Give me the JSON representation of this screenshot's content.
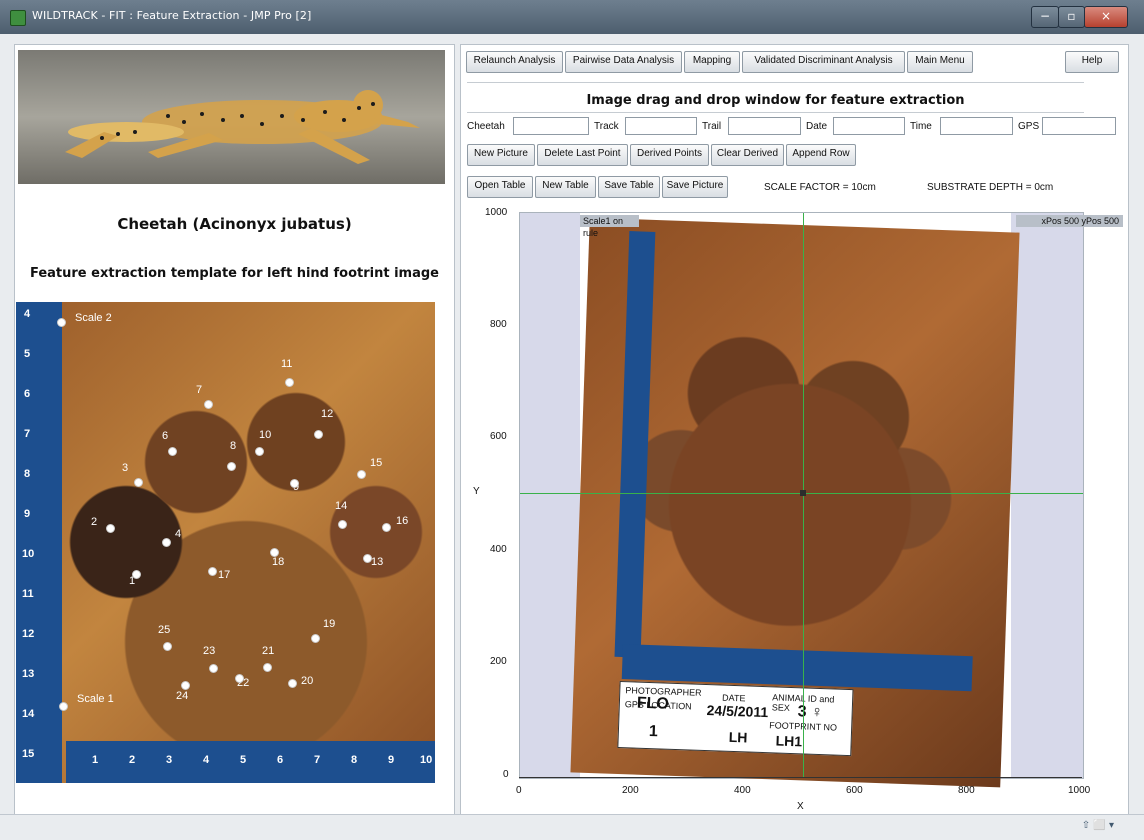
{
  "window": {
    "title": "WILDTRACK - FIT : Feature Extraction - JMP Pro [2]"
  },
  "left": {
    "species": "Cheetah (Acinonyx jubatus)",
    "template_title": "Feature extraction template for left hind footrint image",
    "scale2": "Scale 2",
    "scale1": "Scale 1",
    "landmarks": [
      "1",
      "2",
      "3",
      "4",
      "6",
      "7",
      "8",
      "9",
      "10",
      "11",
      "12",
      "13",
      "14",
      "15",
      "16",
      "17",
      "18",
      "19",
      "20",
      "21",
      "22",
      "23",
      "24",
      "25"
    ],
    "left_ruler": [
      "4",
      "5",
      "6",
      "7",
      "8",
      "9",
      "10",
      "11",
      "12",
      "13",
      "14",
      "15"
    ],
    "bottom_ruler": [
      "1",
      "2",
      "3",
      "4",
      "5",
      "6",
      "7",
      "8",
      "9",
      "10"
    ]
  },
  "toolbar": {
    "relaunch": "Relaunch Analysis",
    "pairwise": "Pairwise Data Analysis",
    "mapping": "Mapping",
    "validated": "Validated Discriminant Analysis",
    "main_menu": "Main Menu",
    "help": "Help"
  },
  "right": {
    "window_title": "Image drag and drop window for feature extraction",
    "fields": {
      "cheetah": "Cheetah",
      "track": "Track",
      "trail": "Trail",
      "date": "Date",
      "time": "Time",
      "gps": "GPS"
    },
    "actions": {
      "new_picture": "New Picture",
      "delete_last_point": "Delete Last Point",
      "derived_points": "Derived Points",
      "clear_derived": "Clear Derived",
      "append_row": "Append Row",
      "open_table": "Open Table",
      "new_table": "New Table",
      "save_table": "Save Table",
      "save_picture": "Save Picture"
    },
    "scale_factor": "SCALE FACTOR = 10cm",
    "substrate_depth": "SUBSTRATE DEPTH = 0cm",
    "plot": {
      "top_left_label": "Scale1 on rule",
      "top_right_label": "xPos 500  yPos 500",
      "y_label": "Y",
      "x_label": "X",
      "y_ticks": [
        "1000",
        "800",
        "600",
        "400",
        "200",
        "0"
      ],
      "x_ticks": [
        "0",
        "200",
        "400",
        "600",
        "800",
        "1000"
      ],
      "card": {
        "photographer": "PHOTOGRAPHER",
        "date_label": "DATE",
        "gps_location": "GPS LOCATION",
        "animal_label": "ANIMAL ID and SEX",
        "footprint_label": "FOOTPRINT NO",
        "photographer_value": "FLO",
        "date_value": "24/5/2011",
        "animal_value": "3 ♀",
        "gps_value": "1",
        "footprint_value": "LH",
        "footprint_value2": "LH1"
      }
    }
  },
  "status": {
    "icons": "⇧ ⬜ ▾"
  }
}
